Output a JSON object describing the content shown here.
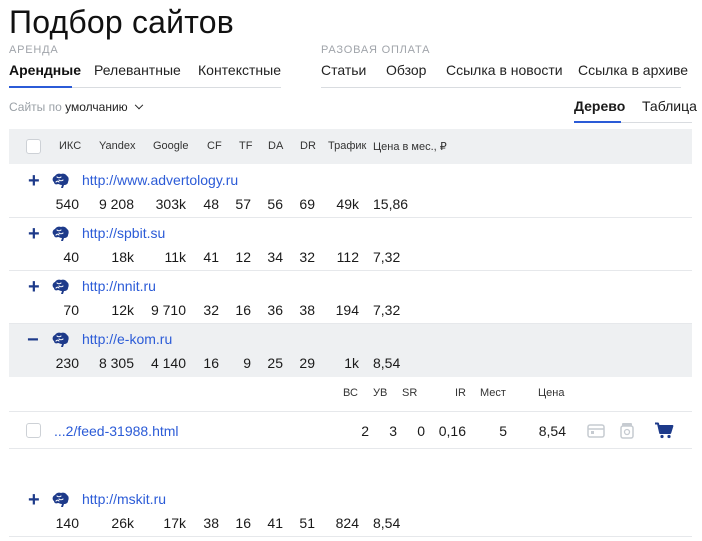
{
  "title": "Подбор сайтов",
  "groups": {
    "rent_label": "АРЕНДА",
    "once_label": "РАЗОВАЯ ОПЛАТА"
  },
  "rent_tabs": [
    "Арендные",
    "Релевантные",
    "Контекстные"
  ],
  "once_tabs": [
    "Статьи",
    "Обзор",
    "Ссылка в новости",
    "Ссылка в архиве"
  ],
  "sort": {
    "prefix": "Сайты по",
    "value": "умолчанию"
  },
  "view_tabs": [
    "Дерево",
    "Таблица"
  ],
  "columns": [
    "ИКС",
    "Yandex",
    "Google",
    "CF",
    "TF",
    "DA",
    "DR",
    "Трафик",
    "Цена в мес., ₽"
  ],
  "rows": [
    {
      "toggle": "+",
      "url": "http://www.advertology.ru",
      "values": [
        "540",
        "9 208",
        "303k",
        "48",
        "57",
        "56",
        "69",
        "49k",
        "15,86"
      ]
    },
    {
      "toggle": "+",
      "url": "http://spbit.su",
      "values": [
        "40",
        "18k",
        "11k",
        "41",
        "12",
        "34",
        "32",
        "112",
        "7,32"
      ]
    },
    {
      "toggle": "+",
      "url": "http://nnit.ru",
      "values": [
        "70",
        "12k",
        "9 710",
        "32",
        "16",
        "36",
        "38",
        "194",
        "7,32"
      ]
    },
    {
      "toggle": "−",
      "url": "http://e-kom.ru",
      "values": [
        "230",
        "8 305",
        "4 140",
        "16",
        "9",
        "25",
        "29",
        "1k",
        "8,54"
      ]
    },
    {
      "toggle": "+",
      "url": "http://mskit.ru",
      "values": [
        "140",
        "26k",
        "17k",
        "38",
        "16",
        "41",
        "51",
        "824",
        "8,54"
      ]
    }
  ],
  "sub_columns": [
    "ВС",
    "УВ",
    "SR",
    "IR",
    "Мест",
    "Цена"
  ],
  "sub_row": {
    "url": "...2/feed-31988.html",
    "values": [
      "2",
      "3",
      "0",
      "0,16",
      "5",
      "8,54"
    ]
  },
  "colors": {
    "accent": "#2b5bd7",
    "dark_blue": "#1d3a8a",
    "header_bg": "#eef0f2"
  }
}
